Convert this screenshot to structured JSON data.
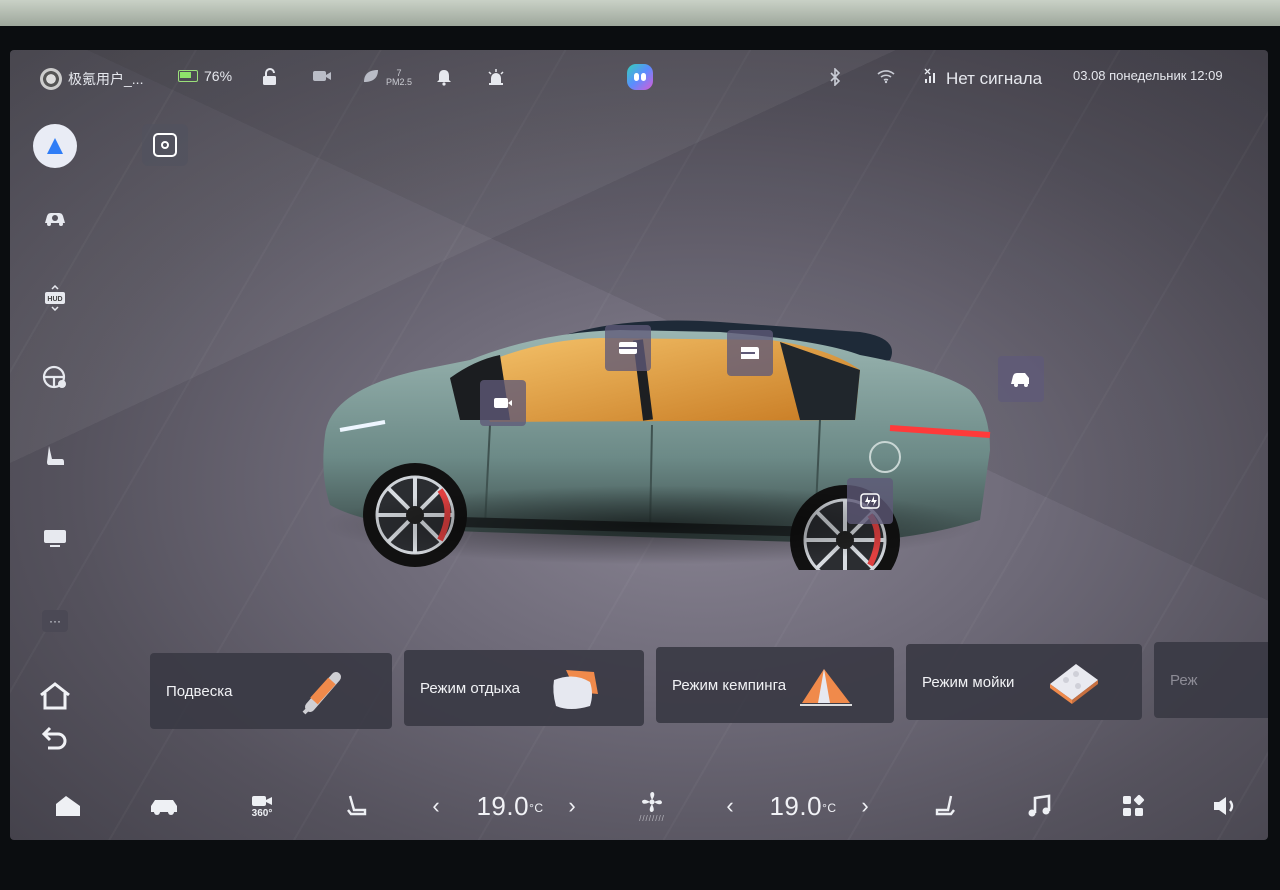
{
  "status_bar": {
    "user_name": "极氪用户_...",
    "battery_percent": "76%",
    "pm_value": "7",
    "pm_label": "PM2.5",
    "signal_text": "Нет сигнала",
    "datetime": "03.08 понедельник 12:09"
  },
  "sidebar": {
    "items": [
      {
        "icon": "navigation-icon"
      },
      {
        "icon": "camera-car-icon"
      },
      {
        "icon": "hud-icon",
        "label": "HUD"
      },
      {
        "icon": "steering-wheel-icon"
      },
      {
        "icon": "seat-icon"
      },
      {
        "icon": "display-icon"
      },
      {
        "icon": "more-icon",
        "label": "···"
      },
      {
        "icon": "home-icon"
      },
      {
        "icon": "back-icon"
      }
    ]
  },
  "mode_cards": [
    {
      "label": "Подвеска",
      "illustration": "suspension-icon"
    },
    {
      "label": "Режим отдыха",
      "illustration": "pillow-icon"
    },
    {
      "label": "Режим кемпинга",
      "illustration": "tent-icon"
    },
    {
      "label": "Режим мойки",
      "illustration": "sponge-icon"
    },
    {
      "label": "Реж",
      "illustration": ""
    }
  ],
  "dock": {
    "left_temp": "19.0",
    "right_temp": "19.0",
    "temp_unit": "°C",
    "cam_label": "360°"
  },
  "colors": {
    "accent_blue": "#2f7df6",
    "battery_green": "#8ee26b",
    "car_body": "#6f8d8a",
    "interior": "#e7a240",
    "tail_light": "#ff3a3a"
  }
}
